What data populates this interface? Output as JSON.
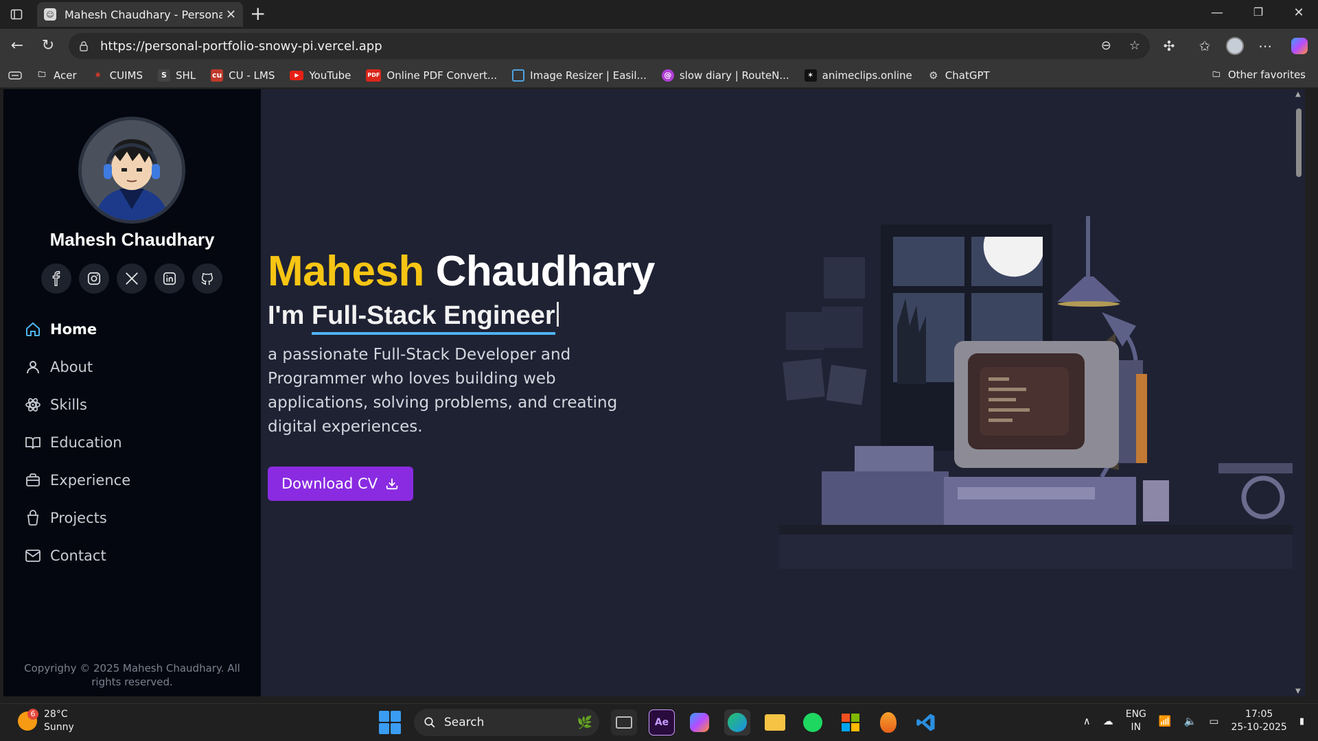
{
  "browser": {
    "tab_title": "Mahesh Chaudhary - Personal Portfolio",
    "url": "https://personal-portfolio-snowy-pi.vercel.app",
    "bookmarks": [
      "Acer",
      "CUIMS",
      "SHL",
      "CU - LMS",
      "YouTube",
      "Online PDF Convert...",
      "Image Resizer | Easil...",
      "slow diary | RouteN...",
      "animeclips.online",
      "ChatGPT"
    ],
    "other_favorites": "Other favorites"
  },
  "sidebar": {
    "name": "Mahesh Chaudhary",
    "socials": [
      "facebook-icon",
      "instagram-icon",
      "x-icon",
      "linkedin-icon",
      "github-icon"
    ],
    "nav": [
      {
        "label": "Home",
        "icon": "home-icon",
        "active": true
      },
      {
        "label": "About",
        "icon": "user-icon",
        "active": false
      },
      {
        "label": "Skills",
        "icon": "atom-icon",
        "active": false
      },
      {
        "label": "Education",
        "icon": "book-icon",
        "active": false
      },
      {
        "label": "Experience",
        "icon": "briefcase-icon",
        "active": false
      },
      {
        "label": "Projects",
        "icon": "cup-icon",
        "active": false
      },
      {
        "label": "Contact",
        "icon": "mail-icon",
        "active": false
      }
    ],
    "copyright": "Copyrighy © 2025 Mahesh Chaudhary. All rights reserved."
  },
  "hero": {
    "first_name": "Mahesh",
    "last_name": "Chaudhary",
    "role_prefix": "I'm",
    "role": "Full-Stack Engineer",
    "description": "a passionate Full-Stack Developer and Programmer who loves building web applications, solving problems, and creating digital experiences.",
    "cv_button": "Download CV"
  },
  "taskbar": {
    "temperature": "28°C",
    "weather": "Sunny",
    "weather_badge": "6",
    "search_label": "Search",
    "lang_top": "ENG",
    "lang_bottom": "IN",
    "time": "17:05",
    "date": "25-10-2025"
  },
  "colors": {
    "accent_yellow": "#f7c514",
    "button_purple": "#8a2be2",
    "underline_blue": "#4fb3f2",
    "page_bg": "#1f2233",
    "sidebar_bg": "#04070f"
  }
}
